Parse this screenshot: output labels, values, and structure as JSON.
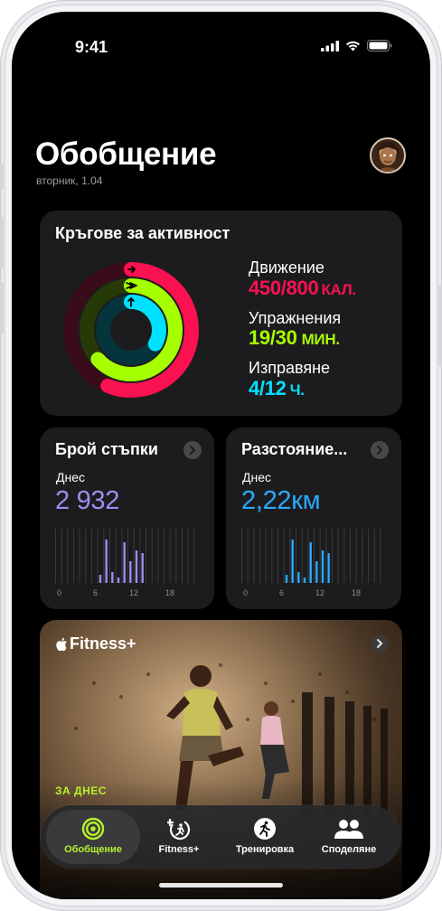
{
  "status_bar": {
    "time": "9:41"
  },
  "header": {
    "title": "Обобщение",
    "date": "вторник, 1.04"
  },
  "activity": {
    "title": "Кръгове за активност",
    "move": {
      "label": "Движение",
      "value": "450/800",
      "unit": "КАЛ.",
      "progress": 0.5625
    },
    "exercise": {
      "label": "Упражнения",
      "value": "19/30",
      "unit": "МИН.",
      "progress": 0.6333
    },
    "stand": {
      "label": "Изправяне",
      "value": "4/12",
      "unit": "Ч.",
      "progress": 0.3333
    },
    "colors": {
      "move": "#fa114f",
      "exercise": "#a6ff00",
      "stand": "#00e0ff"
    }
  },
  "steps": {
    "title": "Брой стъпки",
    "today_label": "Днес",
    "value": "2 932",
    "color": "#9d8df1",
    "axis": [
      "0",
      "6",
      "12",
      "18"
    ],
    "bars": [
      0,
      0,
      0,
      0,
      0,
      0,
      0,
      0.15,
      0.8,
      0.2,
      0.1,
      0.75,
      0.4,
      0.6,
      0.55,
      0,
      0,
      0,
      0,
      0,
      0,
      0,
      0,
      0
    ]
  },
  "distance": {
    "title": "Разстояние...",
    "today_label": "Днес",
    "value": "2,22км",
    "color": "#2aa9ff",
    "axis": [
      "0",
      "6",
      "12",
      "18"
    ],
    "bars": [
      0,
      0,
      0,
      0,
      0,
      0,
      0,
      0.15,
      0.8,
      0.2,
      0.1,
      0.75,
      0.4,
      0.6,
      0.55,
      0,
      0,
      0,
      0,
      0,
      0,
      0,
      0,
      0
    ]
  },
  "fitness_plus": {
    "brand": "Fitness+",
    "eyebrow": "ЗА ДНЕС"
  },
  "tabs": [
    {
      "label": "Обобщение",
      "icon": "activity-rings-icon",
      "active": true
    },
    {
      "label": "Fitness+",
      "icon": "fitness-plus-icon",
      "active": false
    },
    {
      "label": "Тренировка",
      "icon": "running-figure-icon",
      "active": false
    },
    {
      "label": "Споделяне",
      "icon": "people-icon",
      "active": false
    }
  ]
}
